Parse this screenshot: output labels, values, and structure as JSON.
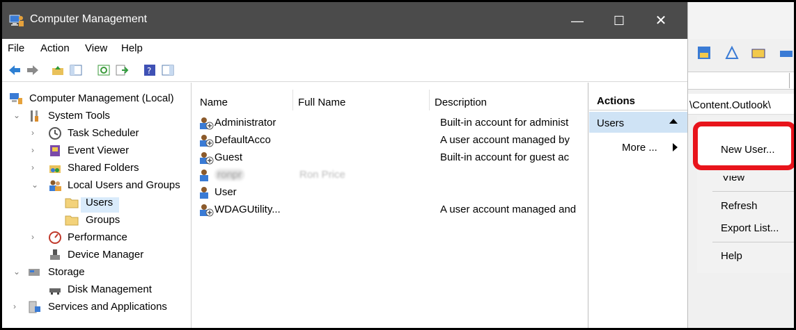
{
  "window": {
    "title": "Computer Management",
    "minimize": "—",
    "maximize": "☐",
    "close": "✕"
  },
  "menu": [
    "File",
    "Action",
    "View",
    "Help"
  ],
  "tree": {
    "root": "Computer Management (Local)",
    "system_tools": "System Tools",
    "task_scheduler": "Task Scheduler",
    "event_viewer": "Event Viewer",
    "shared_folders": "Shared Folders",
    "local_users_groups": "Local Users and Groups",
    "users": "Users",
    "groups": "Groups",
    "performance": "Performance",
    "device_manager": "Device Manager",
    "storage": "Storage",
    "disk_management": "Disk Management",
    "services_apps": "Services and Applications"
  },
  "list": {
    "columns": [
      "Name",
      "Full Name",
      "Description"
    ],
    "rows": [
      {
        "name": "Administrator",
        "full_name": "",
        "description": "Built-in account for administ"
      },
      {
        "name": "DefaultAcco",
        "full_name": "",
        "description": "A user account managed by"
      },
      {
        "name": "Guest",
        "full_name": "",
        "description": "Built-in account for guest ac"
      },
      {
        "name": "ronpr",
        "full_name": "Ron Price",
        "description": ""
      },
      {
        "name": "User",
        "full_name": "",
        "description": ""
      },
      {
        "name": "WDAGUtility...",
        "full_name": "",
        "description": "A user account managed and"
      }
    ]
  },
  "actions": {
    "header": "Actions",
    "section": "Users",
    "more": "More ..."
  },
  "overlay": {
    "path": "\\Content.Outlook\\",
    "menu": {
      "new_user": "New User...",
      "view": "View",
      "refresh": "Refresh",
      "export_list": "Export List...",
      "help": "Help"
    }
  },
  "colors": {
    "titlebar": "#4b4b4b",
    "selection": "#d9ebfb",
    "actions_section": "#cfe3f5",
    "highlight": "#e8141b"
  }
}
